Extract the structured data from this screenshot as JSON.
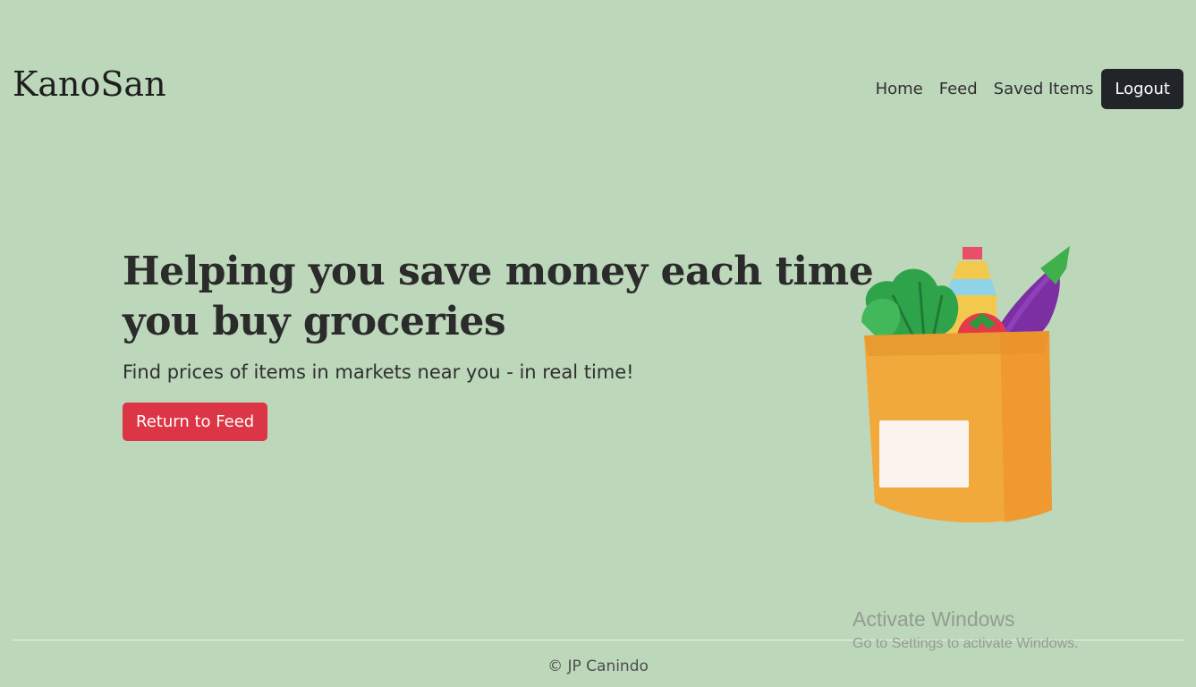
{
  "nav": {
    "brand": "KanoSan",
    "links": [
      "Home",
      "Feed",
      "Saved Items"
    ],
    "logout_label": "Logout"
  },
  "hero": {
    "title": "Helping you save money each time you buy groceries",
    "subtitle": "Find prices of items in markets near you - in real time!",
    "button_label": "Return to Feed"
  },
  "footer": {
    "text": "© JP Canindo"
  },
  "watermark": {
    "title": "Activate Windows",
    "subtitle": "Go to Settings to activate Windows."
  },
  "colors": {
    "background": "#bdd7bb",
    "logout_button": "#212529",
    "feed_button": "#dc3545"
  },
  "illustration": {
    "icon": "grocery-bag-icon"
  }
}
